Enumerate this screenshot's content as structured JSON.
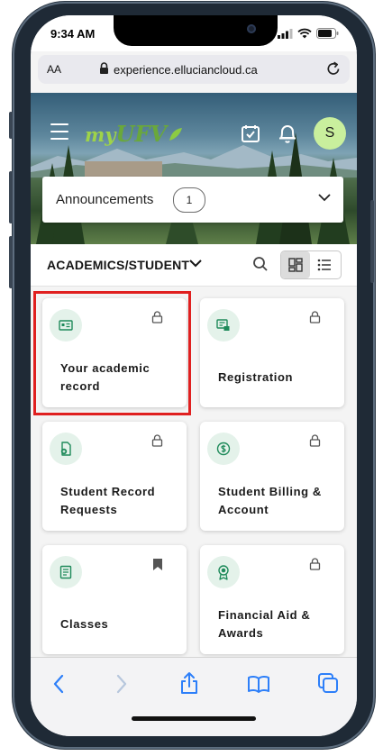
{
  "status_bar": {
    "time": "9:34 AM"
  },
  "browser": {
    "aa_label": "AA",
    "url": "experience.elluciancloud.ca"
  },
  "header": {
    "logo_my": "my",
    "logo_ufv": "UFV",
    "avatar_initial": "S"
  },
  "announcements": {
    "label": "Announcements",
    "count": "1"
  },
  "section": {
    "title": "ACADEMICS/STUDENT"
  },
  "cards": [
    {
      "title": "Your academic record",
      "icon": "id-card-icon",
      "status": "locked"
    },
    {
      "title": "Registration",
      "icon": "registration-icon",
      "status": "locked"
    },
    {
      "title": "Student Record Requests",
      "icon": "document-request-icon",
      "status": "locked"
    },
    {
      "title": "Student Billing & Account",
      "icon": "dollar-icon",
      "status": "locked"
    },
    {
      "title": "Classes",
      "icon": "book-icon",
      "status": "bookmarked"
    },
    {
      "title": "Financial Aid & Awards",
      "icon": "award-icon",
      "status": "locked"
    }
  ],
  "colors": {
    "accent_green": "#1e8a5a",
    "icon_bg": "#e4f2ea",
    "highlight_red": "#e02020",
    "avatar_bg": "#c9ef9d",
    "safari_blue": "#2d7ff9"
  }
}
